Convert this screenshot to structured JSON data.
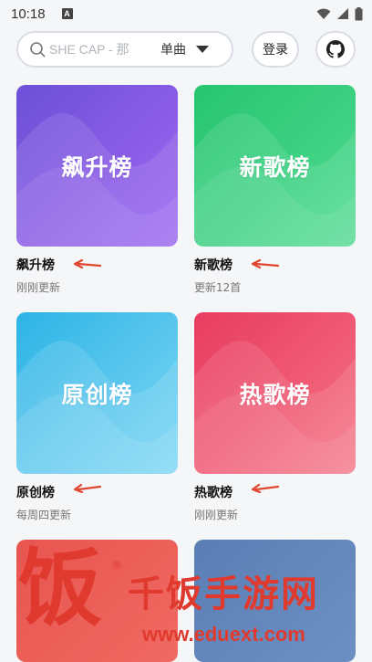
{
  "status_bar": {
    "time": "10:18",
    "notification_icon": "A"
  },
  "search": {
    "placeholder": "SHE CAP - 那",
    "type": "单曲"
  },
  "header": {
    "login_label": "登录"
  },
  "charts": [
    {
      "cover_title": "飙升榜",
      "name": "飙升榜",
      "subtitle": "刚刚更新",
      "accent": "#7b55e0"
    },
    {
      "cover_title": "新歌榜",
      "name": "新歌榜",
      "subtitle": "更新12首",
      "accent": "#34cc7c"
    },
    {
      "cover_title": "原创榜",
      "name": "原创榜",
      "subtitle": "每周四更新",
      "accent": "#4cc0ec"
    },
    {
      "cover_title": "热歌榜",
      "name": "热歌榜",
      "subtitle": "刚刚更新",
      "accent": "#ee5068"
    },
    {
      "cover_title": "",
      "name": "",
      "subtitle": "",
      "accent": "#ec6058"
    },
    {
      "cover_title": "",
      "name": "",
      "subtitle": "",
      "accent": "#6587bb"
    }
  ],
  "watermark": {
    "logo_char": "饭",
    "brand": "千饭手游网",
    "url": "www.eduext.com",
    "registered": "®"
  },
  "colors": {
    "background": "#f5f6f8",
    "annotation_arrow": "#e0452e",
    "watermark": "#e03a2f"
  }
}
